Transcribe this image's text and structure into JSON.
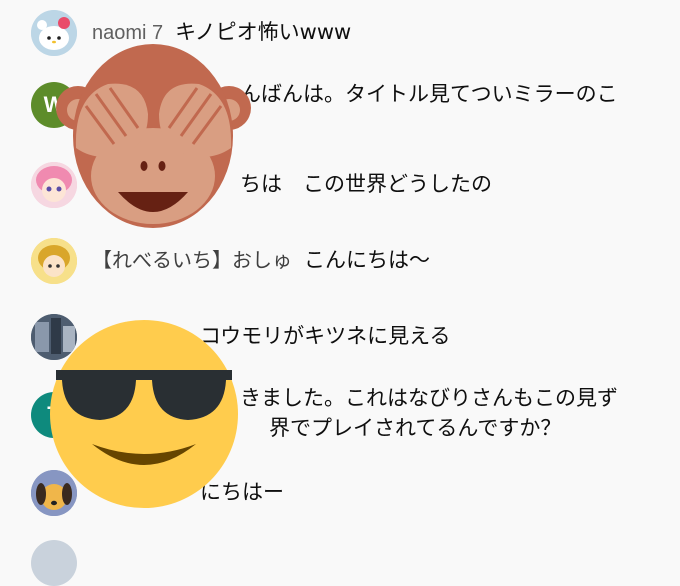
{
  "chat": {
    "messages": [
      {
        "author": "naomi 7",
        "text": "キノピオ怖いwww",
        "avatar_letter": "",
        "avatar_color": "#cfe0ea"
      },
      {
        "author": "",
        "text": "んばんは。タイトル見てついミラーのこ",
        "avatar_letter": "W",
        "avatar_color": "#5d8c2a"
      },
      {
        "author": "",
        "text": "ちは　この世界どうしたの",
        "avatar_letter": "",
        "avatar_color": "#f4c7d6"
      },
      {
        "author": "【れべるいち】おしゅ",
        "text": "こんにちは〜",
        "avatar_letter": "",
        "avatar_color": "#f3d36b"
      },
      {
        "author": "",
        "text": "コウモリがキツネに見える",
        "avatar_letter": "",
        "avatar_color": "#5b6a7c"
      },
      {
        "author": "",
        "text": "きました。これはなびりさんもこの見ず",
        "text2": "界でプレイされてるんですか？",
        "avatar_letter": "T",
        "avatar_color": "#0e8a7d"
      },
      {
        "author": "",
        "text": "にちはー",
        "avatar_letter": "",
        "avatar_color": "#7e8db8"
      }
    ]
  },
  "overlays": {
    "monkey": {
      "icon": "see-no-evil-monkey-emoji",
      "skin": "#c1694f",
      "face": "#d99e82"
    },
    "sunglasses": {
      "icon": "smiling-face-with-sunglasses-emoji",
      "face": "#ffcc4d",
      "glasses": "#292f33"
    }
  }
}
